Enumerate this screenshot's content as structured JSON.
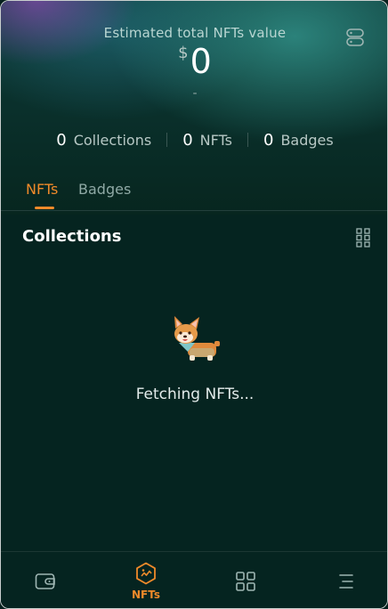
{
  "header": {
    "estimated_label": "Estimated total NFTs value",
    "currency_symbol": "$",
    "value": "0",
    "change": "-"
  },
  "stats": [
    {
      "count": "0",
      "label": "Collections"
    },
    {
      "count": "0",
      "label": "NFTs"
    },
    {
      "count": "0",
      "label": "Badges"
    }
  ],
  "tabs": [
    {
      "label": "NFTs",
      "active": true
    },
    {
      "label": "Badges",
      "active": false
    }
  ],
  "section": {
    "title": "Collections"
  },
  "loading": {
    "text": "Fetching NFTs..."
  },
  "nav": {
    "items": [
      {
        "icon": "wallet-icon",
        "label": ""
      },
      {
        "icon": "nft-icon",
        "label": "NFTs",
        "active": true
      },
      {
        "icon": "apps-grid-icon",
        "label": ""
      },
      {
        "icon": "menu-icon",
        "label": ""
      }
    ]
  },
  "colors": {
    "accent": "#f08a2a",
    "background": "#052420",
    "text": "#ffffff"
  }
}
